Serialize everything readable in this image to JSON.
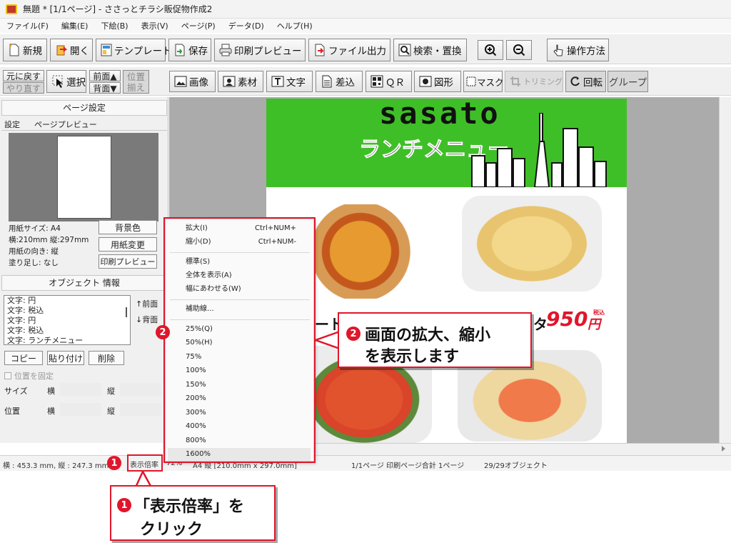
{
  "window": {
    "title": "無題 * [1/1ページ] - ささっとチラシ販促物作成2"
  },
  "menu": [
    "ファイル(F)",
    "編集(E)",
    "下絵(B)",
    "表示(V)",
    "ページ(P)",
    "データ(D)",
    "ヘルプ(H)"
  ],
  "toolbar1": {
    "new": "新規",
    "open": "開く",
    "template": "テンプレート",
    "save": "保存",
    "print_preview": "印刷プレビュー",
    "file_output": "ファイル出力",
    "search_replace": "検索・置換",
    "zoom_in_icon": "zoom-in-icon",
    "zoom_out_icon": "zoom-out-icon",
    "help": "操作方法"
  },
  "toolbar2": {
    "undo": "元に戻す",
    "redo": "やり直す",
    "select": "選択",
    "front": "前面▲",
    "back": "背面▼",
    "position_1": "位置",
    "position_2": "揃え",
    "image": "画像",
    "material": "素材",
    "text": "文字",
    "merge": "差込",
    "qr": "ＱＲ",
    "shape": "図形",
    "mask": "マスク",
    "trimming": "トリミング",
    "rotate": "回転",
    "group": "グループ"
  },
  "left_panel": {
    "page_settings": "ページ設定",
    "tab_settings": "設定",
    "tab_preview": "ページプレビュー",
    "paper_size": "用紙サイズ: A4",
    "dimensions": "横:210mm 縦:297mm",
    "orientation": "用紙の向き: 縦",
    "bleed": "塗り足し: なし",
    "bg_color": "背景色",
    "change_paper": "用紙変更",
    "print_preview": "印刷プレビュー",
    "object_info": "オブジェクト 情報",
    "objects": [
      "文字: 円",
      "文字: 税込",
      "文字: 円",
      "文字: 税込",
      "文字: ランチメニュー"
    ],
    "front": "↑前面",
    "back": "↓背面",
    "copy": "コピー",
    "paste": "貼り付け",
    "delete": "削除",
    "lock_position": "位置を固定",
    "size": "サイズ",
    "position": "位置",
    "width": "横",
    "height": "縦"
  },
  "flyer": {
    "brand": "sasato",
    "heading": "ランチメニュー",
    "price": "950",
    "price_unit": "円",
    "tax_label": "税込",
    "partial_left": "ート",
    "partial_right": "タ"
  },
  "zoom_menu": {
    "items": [
      {
        "label": "拡大(I)",
        "shortcut": "Ctrl+NUM+"
      },
      {
        "label": "縮小(D)",
        "shortcut": "Ctrl+NUM-"
      },
      {
        "label": "標準(S)",
        "shortcut": ""
      },
      {
        "label": "全体を表示(A)",
        "shortcut": ""
      },
      {
        "label": "幅にあわせる(W)",
        "shortcut": ""
      },
      {
        "label": "補助線...",
        "shortcut": ""
      },
      {
        "label": "25%(Q)",
        "shortcut": ""
      },
      {
        "label": "50%(H)",
        "shortcut": ""
      },
      {
        "label": "75%",
        "shortcut": ""
      },
      {
        "label": "100%",
        "shortcut": ""
      },
      {
        "label": "150%",
        "shortcut": ""
      },
      {
        "label": "200%",
        "shortcut": ""
      },
      {
        "label": "300%",
        "shortcut": ""
      },
      {
        "label": "400%",
        "shortcut": ""
      },
      {
        "label": "800%",
        "shortcut": ""
      },
      {
        "label": "1600%",
        "shortcut": ""
      }
    ]
  },
  "status": {
    "coords": "横 : 453.3 mm, 縦 : 247.3 mm",
    "zoom_button": "表示倍率",
    "zoom_value": "72%",
    "paper": "A4 縦 [210.0mm x 297.0mm]",
    "pages": "1/1ページ 印刷ページ合計 1ページ",
    "objects": "29/29オブジェクト"
  },
  "annotations": {
    "step1_num": "1",
    "step1_line1": "「表示倍率」を",
    "step1_line2": "クリック",
    "step2_num": "2",
    "step2_line1": "画面の拡大、縮小",
    "step2_line2": "を表示します"
  },
  "colors": {
    "accent_red": "#e0162b",
    "banner_green": "#3fbf27",
    "price_red": "#e0162b"
  }
}
